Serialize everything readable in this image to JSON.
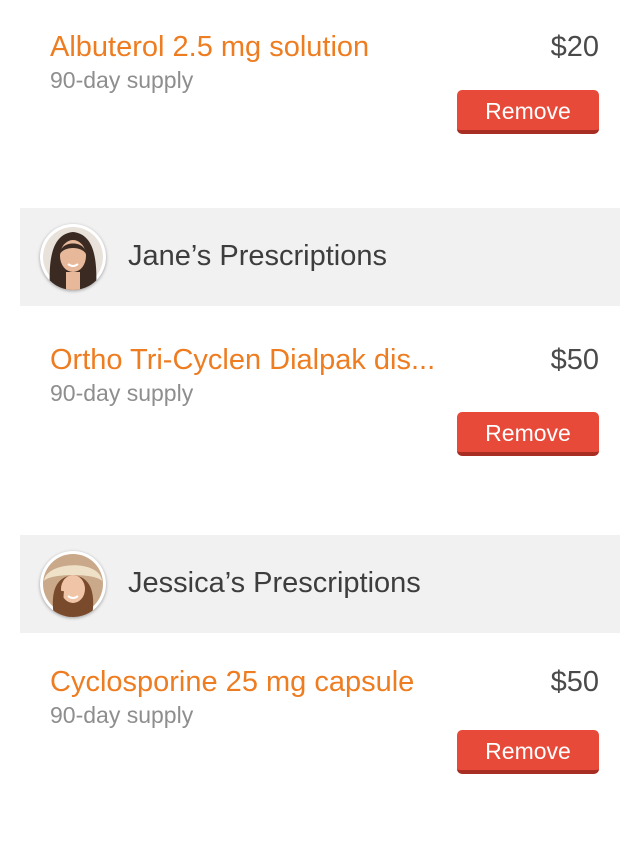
{
  "items_top": {
    "name": "Albuterol 2.5 mg solution",
    "supply": "90-day supply",
    "price": "$20",
    "remove_label": "Remove"
  },
  "sections": [
    {
      "title": "Jane’s Prescriptions",
      "avatar": "jane-avatar",
      "items": [
        {
          "name": "Ortho Tri-Cyclen Dialpak dis...",
          "supply": "90-day supply",
          "price": "$50",
          "remove_label": "Remove"
        }
      ]
    },
    {
      "title": "Jessica’s Prescriptions",
      "avatar": "jessica-avatar",
      "items": [
        {
          "name": "Cyclosporine 25 mg capsule",
          "supply": "90-day supply",
          "price": "$50",
          "remove_label": "Remove"
        }
      ]
    }
  ],
  "colors": {
    "drug_name": "#ee7d22",
    "remove_button": "#e84a3a",
    "header_background": "#f1f1f1"
  }
}
